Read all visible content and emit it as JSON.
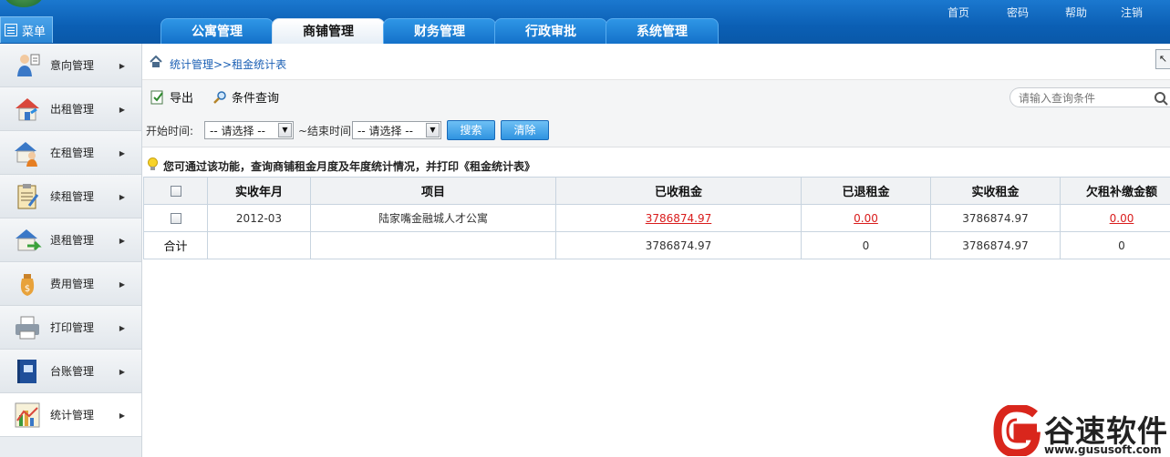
{
  "header": {
    "menu_label": "菜单",
    "tabs": [
      {
        "label": "公寓管理",
        "active": false
      },
      {
        "label": "商铺管理",
        "active": true
      },
      {
        "label": "财务管理",
        "active": false
      },
      {
        "label": "行政审批",
        "active": false
      },
      {
        "label": "系统管理",
        "active": false
      }
    ],
    "links": [
      "首页",
      "密码",
      "帮助",
      "注销"
    ]
  },
  "sidebar": {
    "items": [
      {
        "label": "意向管理",
        "icon": "intent-icon"
      },
      {
        "label": "出租管理",
        "icon": "house-rent-icon"
      },
      {
        "label": "在租管理",
        "icon": "tenant-icon"
      },
      {
        "label": "续租管理",
        "icon": "clipboard-icon"
      },
      {
        "label": "退租管理",
        "icon": "house-return-icon"
      },
      {
        "label": "费用管理",
        "icon": "money-bag-icon"
      },
      {
        "label": "打印管理",
        "icon": "printer-icon"
      },
      {
        "label": "台账管理",
        "icon": "ledger-book-icon"
      },
      {
        "label": "统计管理",
        "icon": "bar-chart-icon",
        "active": true
      }
    ]
  },
  "breadcrumb": "统计管理>>租金统计表",
  "toolbar": {
    "export_label": "导出",
    "query_label": "条件查询",
    "search_placeholder": "请输入查询条件"
  },
  "filter": {
    "start_label": "开始时间:",
    "start_value": "-- 请选择 --",
    "end_label": "~结束时间",
    "end_value": "-- 请选择 --",
    "search_button": "搜索",
    "clear_button": "清除"
  },
  "tip": "您可通过该功能，查询商铺租金月度及年度统计情况，并打印《租金统计表》",
  "table": {
    "columns": [
      "实收年月",
      "项目",
      "已收租金",
      "已退租金",
      "实收租金",
      "欠租补缴金额"
    ],
    "rows": [
      {
        "month": "2012-03",
        "project": "陆家嘴金融城人才公寓",
        "received": "3786874.97",
        "refunded": "0.00",
        "actual": "3786874.97",
        "arrears": "0.00"
      }
    ],
    "total": {
      "label": "合计",
      "received": "3786874.97",
      "refunded": "0",
      "actual": "3786874.97",
      "arrears": "0"
    }
  },
  "watermark": {
    "title": "谷速软件",
    "url": "www.gususoft.com"
  },
  "colors": {
    "header_blue": "#0b5fb4",
    "link_red": "#d91c1c",
    "breadcrumb_blue": "#1a5fb4"
  }
}
